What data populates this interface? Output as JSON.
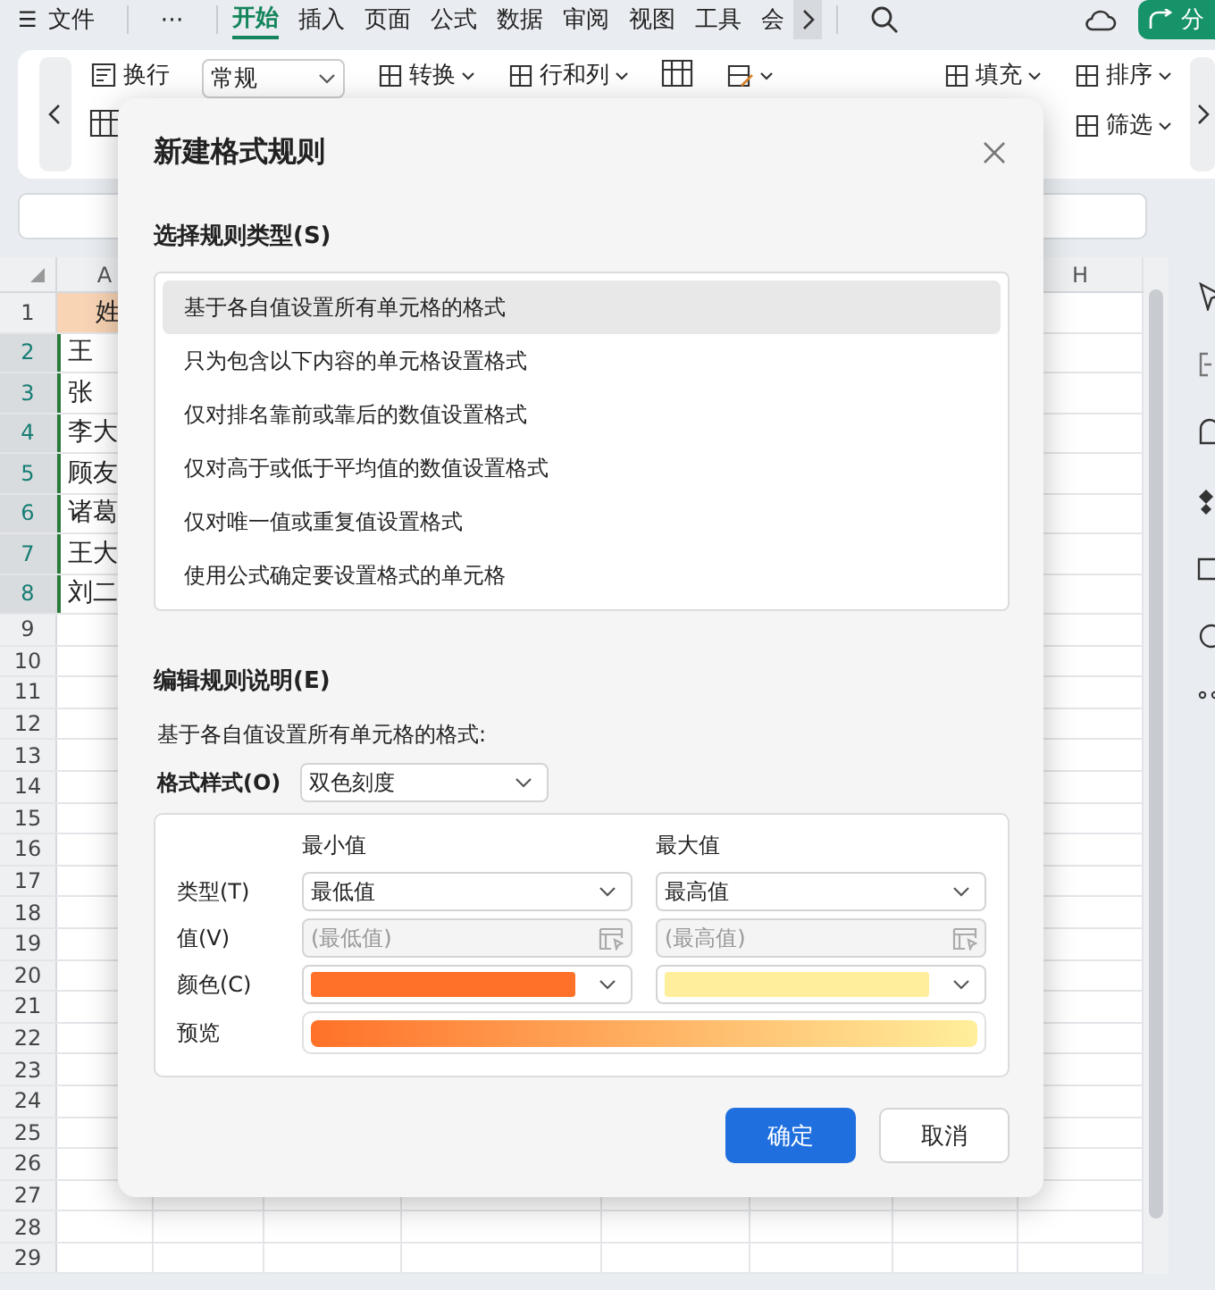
{
  "menu_bar": {
    "menu_icon": "☰",
    "file": "文件",
    "more": "⋯",
    "tabs": [
      {
        "label": "开始",
        "selected": true
      },
      {
        "label": "插入",
        "selected": false
      },
      {
        "label": "页面",
        "selected": false
      },
      {
        "label": "公式",
        "selected": false
      },
      {
        "label": "数据",
        "selected": false
      },
      {
        "label": "审阅",
        "selected": false
      },
      {
        "label": "视图",
        "selected": false
      },
      {
        "label": "工具",
        "selected": false
      },
      {
        "label": "会",
        "selected": false
      }
    ],
    "share": "分"
  },
  "ribbon": {
    "groups": [
      {
        "items": [
          {
            "kind": "text-button",
            "label": "换行"
          },
          {
            "kind": "icon"
          }
        ]
      },
      {
        "items": [
          {
            "kind": "dropdown",
            "label": "常规"
          }
        ]
      },
      {
        "items": [
          {
            "kind": "menu",
            "label": "转换"
          }
        ]
      },
      {
        "items": [
          {
            "kind": "menu",
            "label": "行和列"
          }
        ]
      },
      {
        "items": [
          {
            "kind": "icon"
          }
        ]
      },
      {
        "items": [
          {
            "kind": "icon-menu"
          }
        ]
      },
      {
        "items": [
          {
            "kind": "menu",
            "label": "填充"
          }
        ]
      },
      {
        "items": [
          {
            "kind": "menu",
            "label": "排序"
          },
          {
            "kind": "menu",
            "label": "筛选"
          }
        ]
      }
    ]
  },
  "sheet": {
    "columns": [
      "A",
      "H"
    ],
    "rows": [
      {
        "number": "1",
        "cell": "姓",
        "kind": "header",
        "selected": false
      },
      {
        "number": "2",
        "cell": "王",
        "kind": "data",
        "selected": true
      },
      {
        "number": "3",
        "cell": "张",
        "kind": "data",
        "selected": true
      },
      {
        "number": "4",
        "cell": "李大",
        "kind": "data",
        "selected": true
      },
      {
        "number": "5",
        "cell": "顾友",
        "kind": "data",
        "selected": true
      },
      {
        "number": "6",
        "cell": "诸葛",
        "kind": "data",
        "selected": true
      },
      {
        "number": "7",
        "cell": "王大",
        "kind": "data",
        "selected": true
      },
      {
        "number": "8",
        "cell": "刘二",
        "kind": "data",
        "selected": true
      },
      {
        "number": "9",
        "selected": false
      },
      {
        "number": "10",
        "selected": false
      },
      {
        "number": "11",
        "selected": false
      },
      {
        "number": "12",
        "selected": false
      },
      {
        "number": "13",
        "selected": false
      },
      {
        "number": "14",
        "selected": false
      },
      {
        "number": "15",
        "selected": false
      },
      {
        "number": "16",
        "selected": false
      },
      {
        "number": "17",
        "selected": false
      },
      {
        "number": "18",
        "selected": false
      },
      {
        "number": "19",
        "selected": false
      },
      {
        "number": "20",
        "selected": false
      },
      {
        "number": "21",
        "selected": false
      },
      {
        "number": "22",
        "selected": false
      },
      {
        "number": "23",
        "selected": false
      },
      {
        "number": "24",
        "selected": false
      },
      {
        "number": "25",
        "selected": false
      },
      {
        "number": "26",
        "selected": false
      },
      {
        "number": "27",
        "selected": false
      },
      {
        "number": "28",
        "selected": false
      },
      {
        "number": "29",
        "selected": false
      }
    ]
  },
  "dialog": {
    "title": "新建格式规则",
    "rule_type_label": "选择规则类型(S)",
    "rule_types": [
      {
        "label": "基于各自值设置所有单元格的格式",
        "selected": true
      },
      {
        "label": "只为包含以下内容的单元格设置格式",
        "selected": false
      },
      {
        "label": "仅对排名靠前或靠后的数值设置格式",
        "selected": false
      },
      {
        "label": "仅对高于或低于平均值的数值设置格式",
        "selected": false
      },
      {
        "label": "仅对唯一值或重复值设置格式",
        "selected": false
      },
      {
        "label": "使用公式确定要设置格式的单元格",
        "selected": false
      }
    ],
    "edit_label": "编辑规则说明(E)",
    "description": "基于各自值设置所有单元格的格式:",
    "format_style": {
      "label": "格式样式(O)",
      "value": "双色刻度"
    },
    "scale": {
      "type_label": "类型(T)",
      "value_label": "值(V)",
      "color_label": "颜色(C)",
      "preview_label": "预览",
      "ends": [
        {
          "heading": "最小值",
          "type": "最低值",
          "value": "(最低值)",
          "disabled": true,
          "color": "#ff7128"
        },
        {
          "heading": "最大值",
          "type": "最高值",
          "value": "(最高值)",
          "disabled": true,
          "color": "#ffef9c"
        }
      ]
    },
    "buttons": [
      {
        "label": "确定",
        "kind": "primary"
      },
      {
        "label": "取消",
        "kind": "secondary"
      }
    ]
  }
}
